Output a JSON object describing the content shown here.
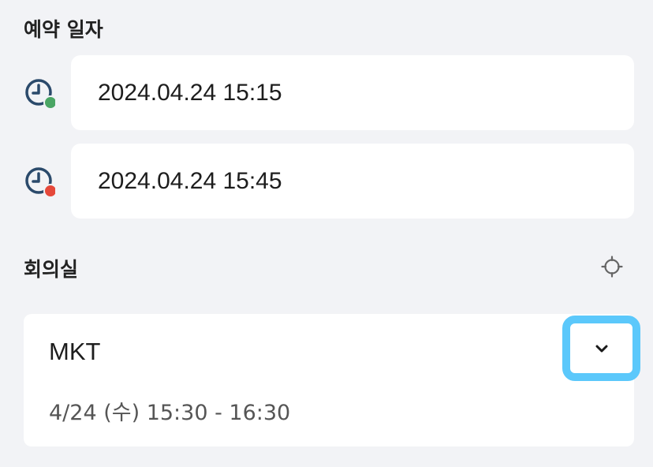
{
  "reservation": {
    "title": "예약 일자",
    "start": {
      "value": "2024.04.24 15:15",
      "icon": "clock-start-icon",
      "status_color": "#4aa564"
    },
    "end": {
      "value": "2024.04.24 15:45",
      "icon": "clock-end-icon",
      "status_color": "#e5483a"
    }
  },
  "meeting_room": {
    "title": "회의실",
    "locate_icon": "crosshair-icon",
    "selected": {
      "name": "MKT",
      "time": "4/24 (수) 15:30 - 16:30"
    },
    "expand_icon": "chevron-down-icon"
  },
  "colors": {
    "icon_navy": "#2b4a6b",
    "highlight": "#5bc8fb",
    "background": "#f2f3f6"
  }
}
